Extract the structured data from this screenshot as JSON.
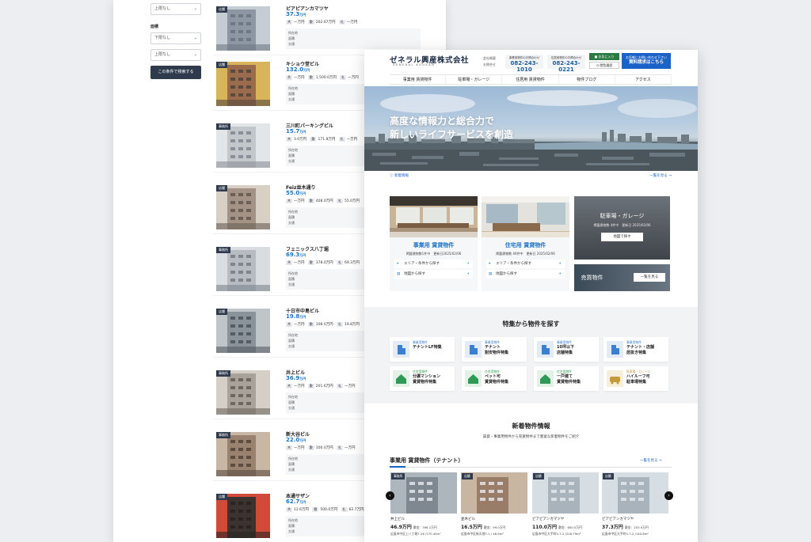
{
  "listing": {
    "filters": {
      "upper_none_1": "上限なし",
      "floor_label": "面積",
      "lower_none": "下限なし",
      "upper_none_2": "上限なし",
      "search_button": "この条件で検索する"
    },
    "items": [
      {
        "tag": "店舗",
        "name": "ピアピアンカマツヤ",
        "price": "37.3",
        "unit": "万円",
        "rent": "一万円",
        "area": "202.67万円",
        "fee": "一万円",
        "updated": "更新日 2025.02.06",
        "addr": "所在地",
        "area_row": "面積",
        "access": "交通"
      },
      {
        "tag": "店舗",
        "name": "キショウ堂ビル",
        "price": "132.0",
        "unit": "万円",
        "rent": "一万円",
        "area": "1,500.0万円",
        "fee": "一万円",
        "addr": "所在地",
        "area_row": "面積",
        "access": "交通"
      },
      {
        "tag": "事務所",
        "name": "三川町パーキングビル",
        "price": "15.7",
        "unit": "万円",
        "rent": "3.0万円",
        "area": "171.8万円",
        "fee": "一万円",
        "addr": "所在地",
        "area_row": "面積",
        "access": "交通"
      },
      {
        "tag": "店舗",
        "name": "Feiz並木通り",
        "price": "55.0",
        "unit": "万円",
        "rent": "一万円",
        "area": "408.0万円",
        "fee": "55.0万円",
        "addr": "所在地",
        "area_row": "面積",
        "access": "交通"
      },
      {
        "tag": "事務所",
        "name": "フェニックス八丁堀",
        "price": "69.3",
        "unit": "万円",
        "rent": "一万円",
        "area": "378.0万円",
        "fee": "69.3万円",
        "addr": "所在地",
        "area_row": "面積",
        "access": "交通"
      },
      {
        "tag": "店舗",
        "name": "十日市中島ビル",
        "price": "19.8",
        "unit": "万円",
        "rent": "一万円",
        "area": "108.0万円",
        "fee": "19.8万円",
        "addr": "所在地",
        "area_row": "面積",
        "access": "交通"
      },
      {
        "tag": "事務所",
        "name": "井上ビル",
        "price": "36.9",
        "unit": "万円",
        "rent": "一万円",
        "area": "201.6万円",
        "fee": "一万円",
        "addr": "所在地",
        "area_row": "面積",
        "access": "交通"
      },
      {
        "tag": "事務所",
        "name": "新大谷ビル",
        "price": "22.0",
        "unit": "万円",
        "rent": "一万円",
        "area": "100.0万円",
        "fee": "一万円",
        "addr": "所在地",
        "area_row": "面積",
        "access": "交通"
      },
      {
        "tag": "店舗",
        "name": "本通サザン",
        "price": "62.7",
        "unit": "万円",
        "rent": "12.6万円",
        "area": "500.0万円",
        "fee": "62.7万円",
        "addr": "所在地",
        "area_row": "面積",
        "access": "交通"
      }
    ]
  },
  "site": {
    "logo": "ゼネラル興産株式会社",
    "logo_sub": "GENERAL KOUSAN",
    "header_link_1": "会社概要",
    "header_link_2": "お問合せ",
    "tel_1_label": "事業用物件のお問合わせ",
    "tel_1": "082-243-1010",
    "tel_2_label": "住居用物件のお問合わせ",
    "tel_2": "082-243-0221",
    "fav_button": "お気に入り",
    "history_button": "閲覧履歴",
    "doc_line_1": "お気軽にお問い合わせ下さい",
    "doc_line_2": "資料請求はこちら",
    "nav": [
      "事業用 賃貸物件",
      "駐車場・ガレージ",
      "住居用 賃貸物件",
      "物件ブログ",
      "アクセス"
    ],
    "hero_line_1": "高度な情報力と総合力で",
    "hero_line_2": "新しいライフサービスを創造",
    "news_label": "新着情報",
    "news_more": "一覧を見る →",
    "card_biz": {
      "title": "事業用 賃貸物件",
      "sub": "掲載建物数1件中　更新日2025/02/06",
      "link_1": "エリア・条件から探す",
      "link_2": "地図から探す"
    },
    "card_home": {
      "title": "住宅用 賃貸物件",
      "sub": "掲載建物数 46件中　更新日 2025/02/06",
      "link_1": "エリア・条件から探す",
      "link_2": "地図から探す"
    },
    "card_parking": {
      "title": "駐車場・ガレージ",
      "sub": "掲載建物数 4件中　更新日 2025/02/06",
      "button": "地図で探す"
    },
    "card_sale": {
      "title": "売買物件",
      "button": "一覧を見る"
    },
    "features_title": "特集から物件を探す",
    "features": [
      {
        "cat": "事業用物件",
        "name1": "テナントLF特集",
        "name2": ""
      },
      {
        "cat": "事業用物件",
        "name1": "テナント",
        "name2": "割安物件特集"
      },
      {
        "cat": "事業用物件",
        "name1": "10坪以下",
        "name2": "店舗特集"
      },
      {
        "cat": "事業用物件",
        "name1": "テナント・店舗",
        "name2": "居抜き特集"
      },
      {
        "cat": "住宅用物件",
        "name1": "分譲マンション",
        "name2": "賃貸物件特集"
      },
      {
        "cat": "住宅用物件",
        "name1": "ペット可",
        "name2": "賃貸物件特集"
      },
      {
        "cat": "住宅用物件",
        "name1": "一戸建て",
        "name2": "賃貸物件特集"
      },
      {
        "cat": "駐車場・ガレージ",
        "name1": "ハイルーフ可",
        "name2": "駐車場特集"
      }
    ],
    "new_title": "新着物件情報",
    "new_sub": "賃貸・事業用物件から売買物件まで豊富な新着物件をご紹介",
    "new_category": "事業用 賃貸物件（テナント）",
    "new_more": "一覧を見る →",
    "new_items": [
      {
        "tag": "事務所",
        "name": "井上ビル",
        "price": "46.9万円",
        "fee": "敷金：396.2万円",
        "addr": "広島市中区上八丁堀7-26 /170.40m²"
      },
      {
        "tag": "店舗",
        "name": "並木ビル",
        "price": "16.5万円",
        "fee": "敷金：99.0万円",
        "addr": "広島市中区新天地7-1 / 48.9m²"
      },
      {
        "tag": "店舗",
        "name": "ピアピアンカマツヤ",
        "price": "110.0万円",
        "fee": "敷金：600.0万円",
        "addr": "広島市中区大手町5-7-2 /218.79m²"
      },
      {
        "tag": "店舗",
        "name": "ピアピアンカマツヤ",
        "price": "37.3万円",
        "fee": "敷金：203.9万円",
        "addr": "広島市中区大手町5-7-2 /140.8m²"
      }
    ],
    "prev_icon": "‹",
    "next_icon": "›"
  }
}
